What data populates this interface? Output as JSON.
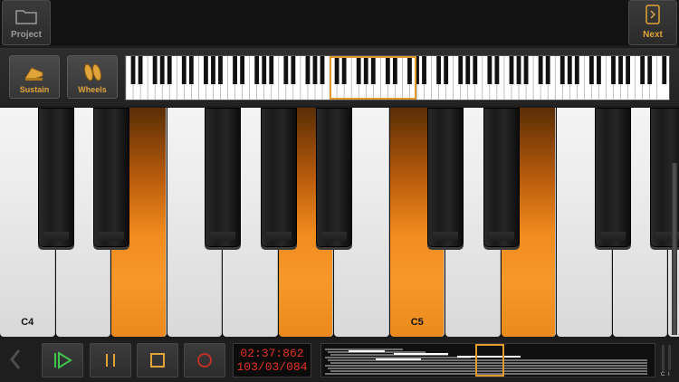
{
  "topbar": {
    "project_label": "Project",
    "next_label": "Next"
  },
  "controls": {
    "sustain_label": "Sustain",
    "wheels_label": "Wheels"
  },
  "keyboard": {
    "white_keys": [
      {
        "note": "C4",
        "label": "C4",
        "active": false
      },
      {
        "note": "D4",
        "label": "",
        "active": false
      },
      {
        "note": "E4",
        "label": "",
        "active": true
      },
      {
        "note": "F4",
        "label": "",
        "active": false
      },
      {
        "note": "G4",
        "label": "",
        "active": false
      },
      {
        "note": "A4",
        "label": "",
        "active": true
      },
      {
        "note": "B4",
        "label": "",
        "active": false
      },
      {
        "note": "C5",
        "label": "C5",
        "active": true
      },
      {
        "note": "D5",
        "label": "",
        "active": false
      },
      {
        "note": "E5",
        "label": "",
        "active": true
      },
      {
        "note": "F5",
        "label": "",
        "active": false
      },
      {
        "note": "G5",
        "label": "",
        "active": false
      },
      {
        "note": "A5",
        "label": "",
        "active": false
      }
    ]
  },
  "transport": {
    "time_line1": "02:37:862",
    "time_line2": "103/03/084",
    "meter_labels": [
      "C",
      "I"
    ]
  },
  "colors": {
    "accent": "#e49a2a",
    "key_active": "#f18b1e",
    "time_display": "#e63225",
    "play_icon": "#3ec44a"
  },
  "icons": {
    "project": "folder-icon",
    "next": "next-arrow-icon",
    "sustain": "sustain-pedal-icon",
    "wheels": "wheels-icon",
    "back": "chevron-left-icon",
    "play": "play-icon",
    "pause": "pause-icon",
    "stop": "stop-icon",
    "record": "record-icon"
  }
}
